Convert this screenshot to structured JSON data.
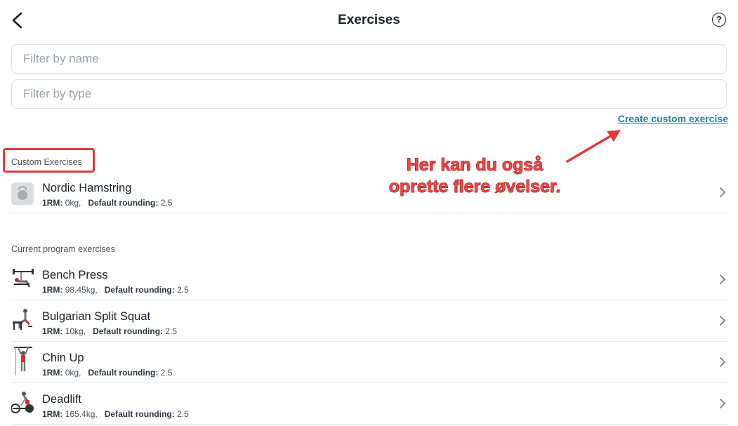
{
  "header": {
    "title": "Exercises",
    "help_label": "?"
  },
  "filters": {
    "name_placeholder": "Filter by name",
    "type_placeholder": "Filter by type"
  },
  "create_link": "Create custom exercise",
  "annotation": {
    "line1": "Her kan du også",
    "line2": "oprette flere øvelser."
  },
  "colors": {
    "annotation": "#ef4b4b",
    "link": "#2e7f9a",
    "highlight_box": "#e0393a"
  },
  "sections": {
    "custom": {
      "label": "Custom Exercises",
      "items": [
        {
          "name": "Nordic Hamstring",
          "orm_label": "1RM:",
          "orm_value": "0kg,",
          "rounding_label": "Default rounding:",
          "rounding_value": "2.5",
          "icon": "kettlebell-icon"
        }
      ]
    },
    "program": {
      "label": "Current program exercises",
      "items": [
        {
          "name": "Bench Press",
          "orm_label": "1RM:",
          "orm_value": "98.45kg,",
          "rounding_label": "Default rounding:",
          "rounding_value": "2.5",
          "icon": "bench-press-icon"
        },
        {
          "name": "Bulgarian Split Squat",
          "orm_label": "1RM:",
          "orm_value": "10kg,",
          "rounding_label": "Default rounding:",
          "rounding_value": "2.5",
          "icon": "split-squat-icon"
        },
        {
          "name": "Chin Up",
          "orm_label": "1RM:",
          "orm_value": "0kg,",
          "rounding_label": "Default rounding:",
          "rounding_value": "2.5",
          "icon": "chin-up-icon"
        },
        {
          "name": "Deadlift",
          "orm_label": "1RM:",
          "orm_value": "165.4kg,",
          "rounding_label": "Default rounding:",
          "rounding_value": "2.5",
          "icon": "deadlift-icon"
        }
      ]
    }
  }
}
